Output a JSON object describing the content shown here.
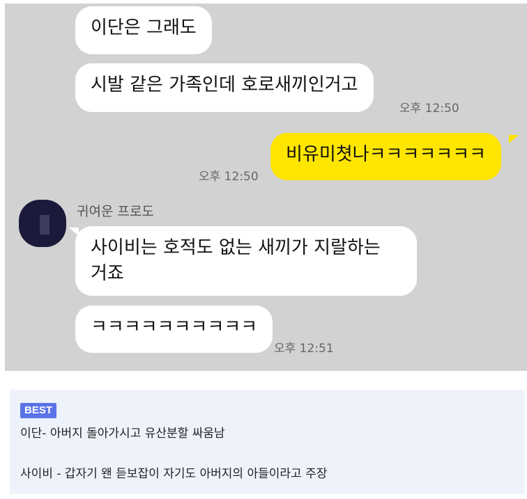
{
  "chat": {
    "messages": [
      {
        "text": "이단은 그래도"
      },
      {
        "text": "시발 같은 가족인데 호로새끼인거고",
        "time": "오후 12:50"
      },
      {
        "text": "비유미쳣나ㅋㅋㅋㅋㅋㅋㅋ",
        "time": "오후 12:50"
      },
      {
        "sender": "귀여운 프로도",
        "text": "사이비는 호적도 없는 새끼가 지랄하는 거죠"
      },
      {
        "text": "ㅋㅋㅋㅋㅋㅋㅋㅋㅋㅋ",
        "time": "오후 12:51"
      }
    ],
    "bubble_mine_color": "#ffe600",
    "bubble_other_color": "#ffffff",
    "background_color": "#d2d2d2"
  },
  "comment": {
    "badge": "BEST",
    "badge_color": "#5a73e6",
    "lines": [
      "이단- 아버지 돌아가시고 유산분할 싸움남",
      "사이비 - 갑자기 왠 듣보잡이 자기도 아버지의 아들이라고 주장"
    ]
  }
}
